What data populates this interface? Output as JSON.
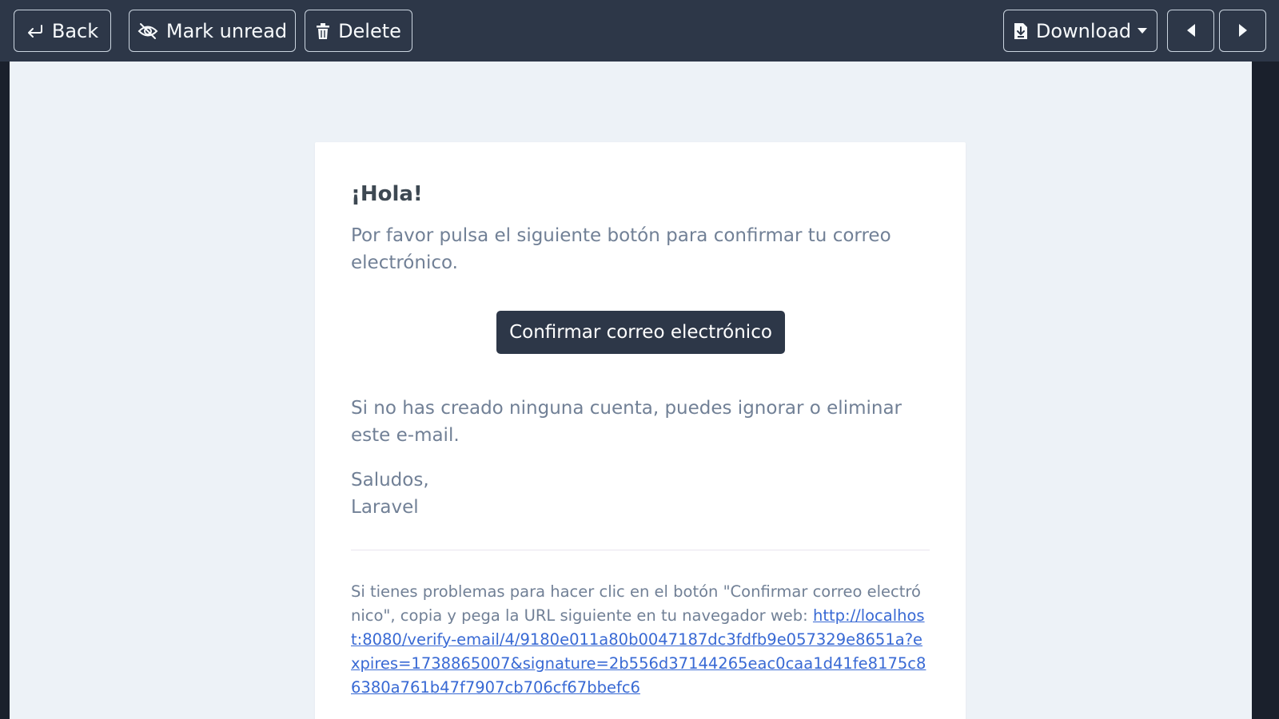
{
  "toolbar": {
    "back_label": "Back",
    "mark_unread_label": "Mark unread",
    "delete_label": "Delete",
    "download_label": "Download"
  },
  "email": {
    "greeting": "¡Hola!",
    "intro": "Por favor pulsa el siguiente botón para confirmar tu correo electrónico.",
    "action_label": "Confirmar correo electrónico",
    "outro": "Si no has creado ninguna cuenta, puedes ignorar o eliminar este e-mail.",
    "salutation": "Saludos,",
    "sender": "Laravel",
    "subcopy_text": "Si tienes problemas para hacer clic en el botón \"Confirmar correo electrónico\", copia y pega la URL siguiente en tu navegador web: ",
    "verify_url": "http://localhost:8080/verify-email/4/9180e011a80b0047187dc3fdfb9e057329e8651a?expires=1738865007&signature=2b556d37144265eac0caa1d41fe8175c86380a761b47f7907cb706cf67bbefc6"
  },
  "colors": {
    "toolbar_bg": "#2d3748",
    "viewer_bg": "#edf2f7",
    "button_dark": "#2d3748",
    "body_text": "#718096",
    "link": "#3869d4"
  }
}
